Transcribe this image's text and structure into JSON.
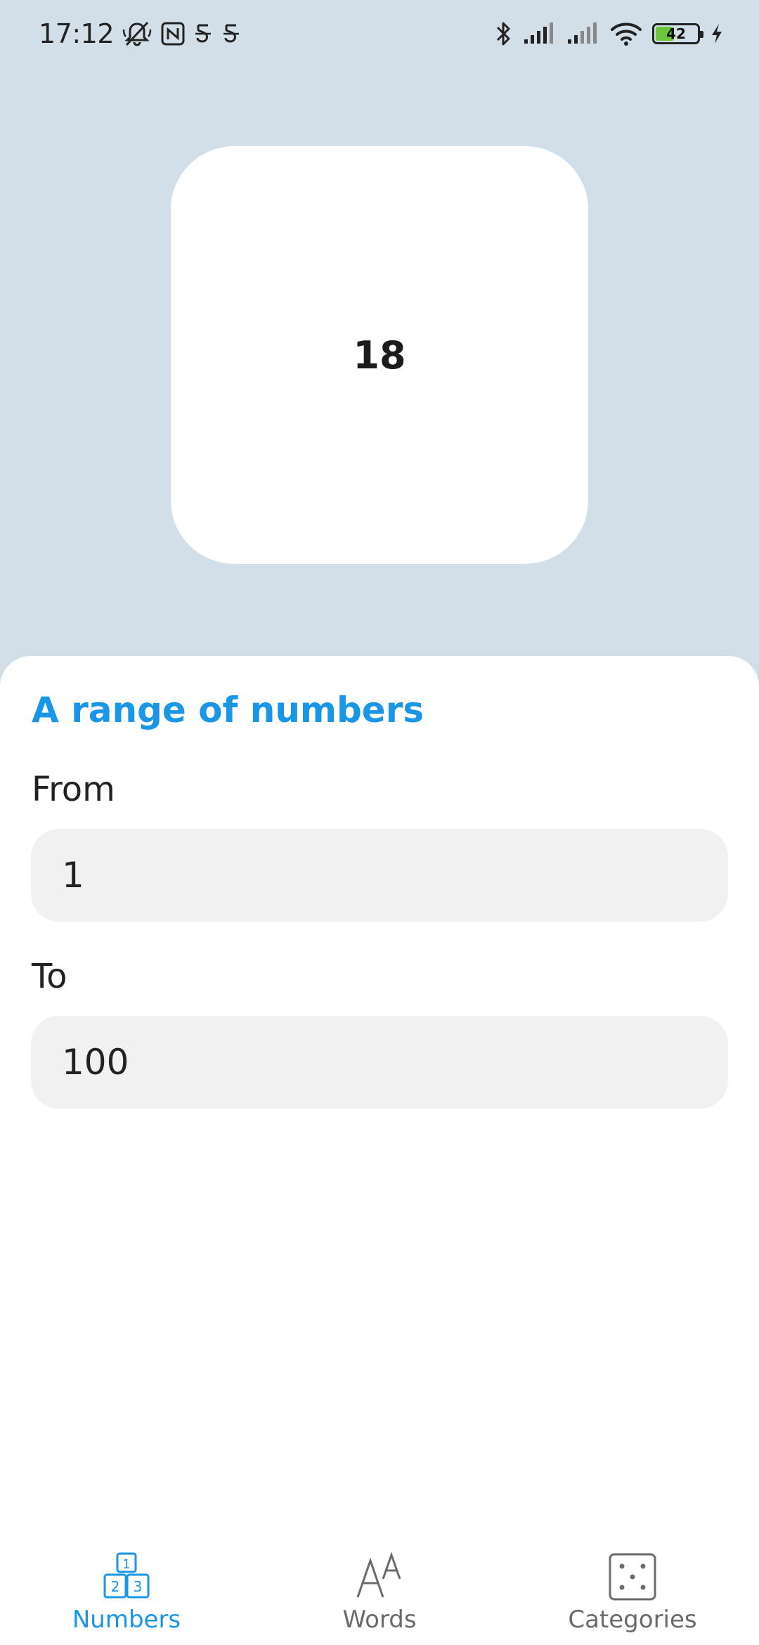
{
  "status_bar": {
    "time": "17:12",
    "battery_level": "42",
    "battery_fraction": 0.42,
    "left_icons": [
      "bell-muted-icon",
      "nfc-icon",
      "app-notification-icon",
      "app-notification-icon"
    ],
    "right_icons": [
      "bluetooth-icon",
      "signal-icon",
      "signal-icon",
      "wifi-icon",
      "battery-icon",
      "charging-icon"
    ]
  },
  "result": {
    "value": "18"
  },
  "range": {
    "title": "A range of numbers",
    "from_label": "From",
    "from_value": "1",
    "to_label": "To",
    "to_value": "100"
  },
  "nav": {
    "items": [
      {
        "label": "Numbers",
        "icon": "number-blocks-icon",
        "active": true
      },
      {
        "label": "Words",
        "icon": "letters-icon",
        "active": false
      },
      {
        "label": "Categories",
        "icon": "dice-icon",
        "active": false
      }
    ]
  },
  "colors": {
    "accent": "#1a96e6",
    "background": "#d3dfe8",
    "inactive": "#6b6b6b"
  }
}
